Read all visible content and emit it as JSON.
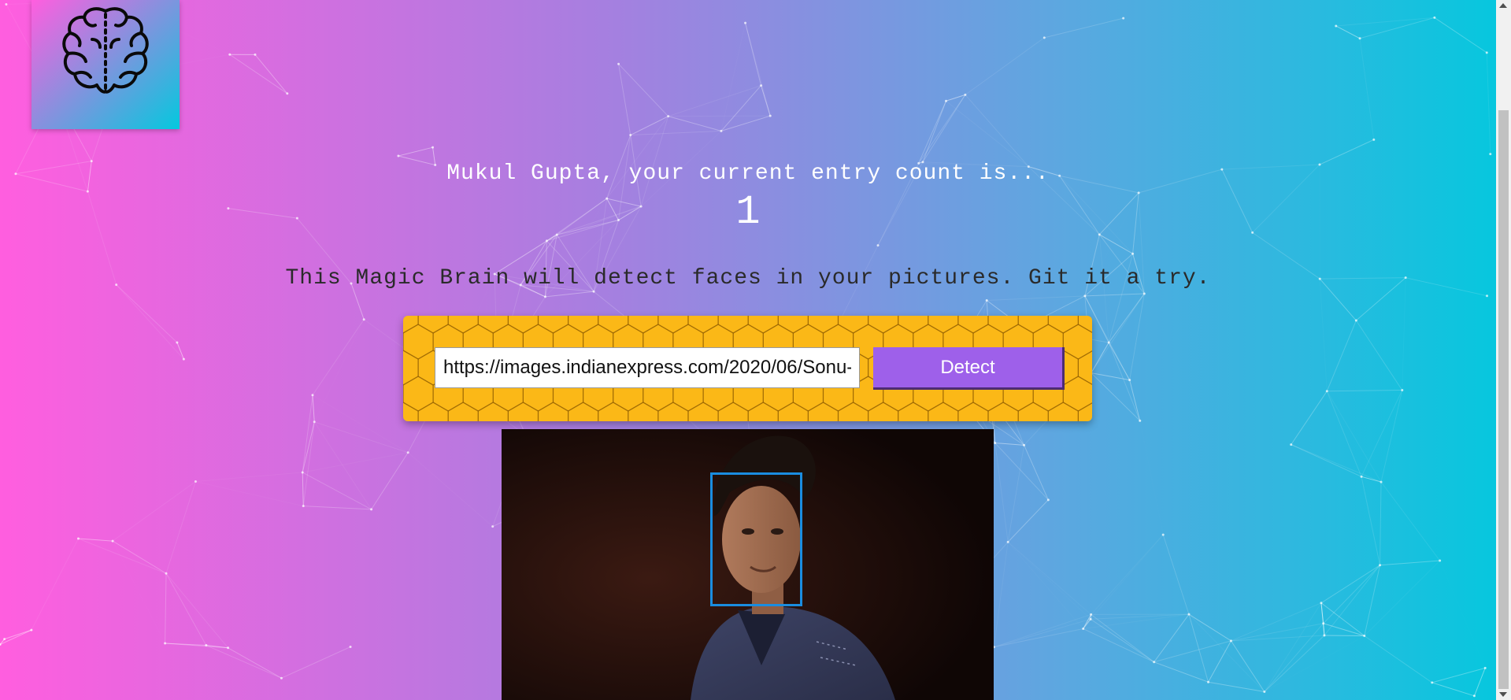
{
  "user": {
    "greeting": "Mukul Gupta, your current entry count is...",
    "entry_count": "1"
  },
  "tagline": "This Magic Brain will detect faces in your pictures. Git it a try.",
  "form": {
    "url_value": "https://images.indianexpress.com/2020/06/Sonu-",
    "detect_label": "Detect"
  },
  "icons": {
    "logo": "brain-icon"
  },
  "colors": {
    "gradient_start": "#ff5edf",
    "gradient_end": "#04c8de",
    "form_panel": "#fbb817",
    "detect_button": "#9e60ea",
    "face_box": "#1a8de0"
  }
}
